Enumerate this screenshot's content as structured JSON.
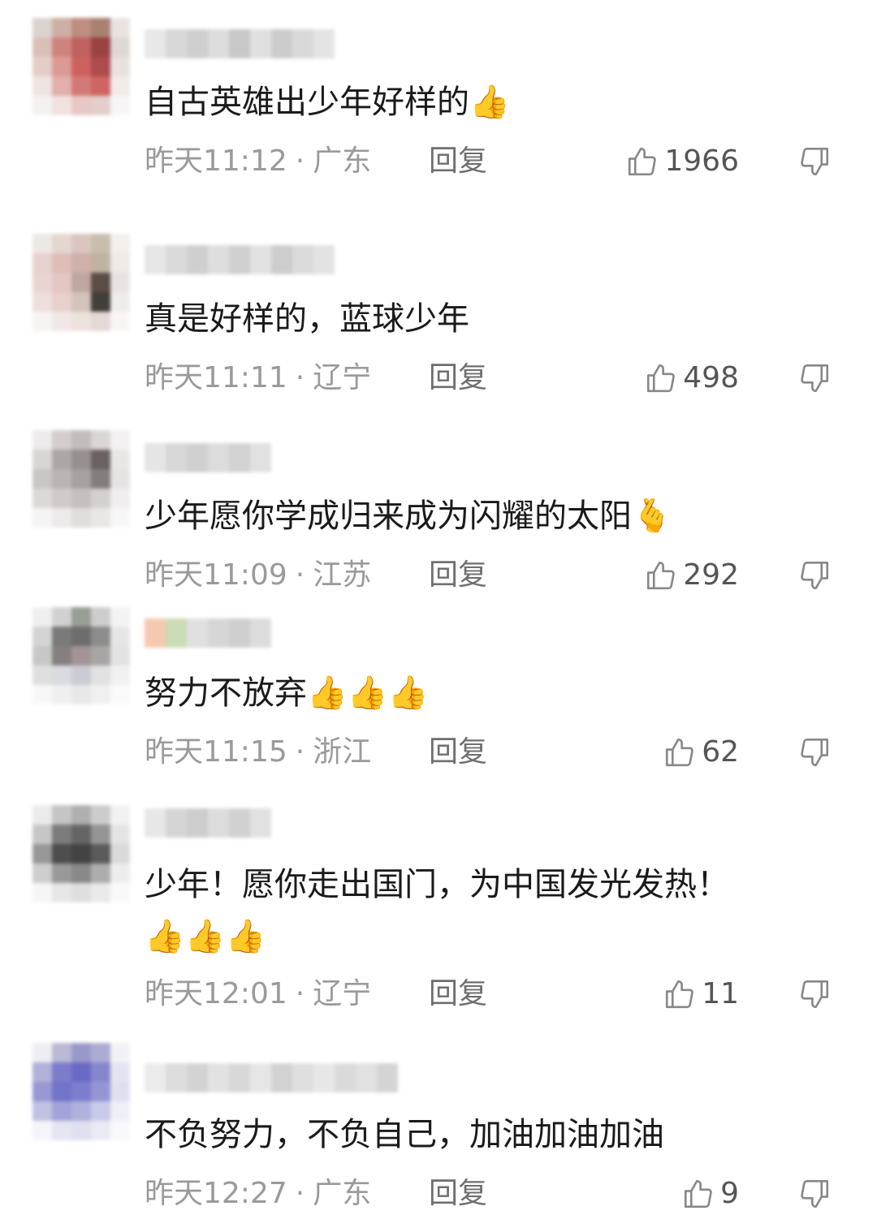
{
  "comments": [
    {
      "text": "自古英雄出少年好样的",
      "emoji": "👍",
      "time": "昨天11:12",
      "location": "广东",
      "reply": "回复",
      "likes": "1966"
    },
    {
      "text": "真是好样的，蓝球少年",
      "emoji": "",
      "time": "昨天11:11",
      "location": "辽宁",
      "reply": "回复",
      "likes": "498"
    },
    {
      "text": "少年愿你学成归来成为闪耀的太阳",
      "emoji": "🫰",
      "time": "昨天11:09",
      "location": "江苏",
      "reply": "回复",
      "likes": "292"
    },
    {
      "text": "努力不放弃",
      "emoji": "👍👍👍",
      "time": "昨天11:15",
      "location": "浙江",
      "reply": "回复",
      "likes": "62"
    },
    {
      "text": "少年！愿你走出国门，为中国发光发热！",
      "emoji2": "👍👍👍",
      "time": "昨天12:01",
      "location": "辽宁",
      "reply": "回复",
      "likes": "11"
    },
    {
      "text": "不负努力，不负自己，加油加油加油",
      "emoji": "",
      "time": "昨天12:27",
      "location": "广东",
      "reply": "回复",
      "likes": "9"
    }
  ],
  "colors": {
    "text": "#1a1a1a",
    "meta": "#9a9a9a",
    "reply": "#6f6f6f",
    "icon": "#888888"
  },
  "icons": {
    "like": "thumbs-up-outline-icon",
    "dislike": "thumbs-down-outline-icon"
  }
}
